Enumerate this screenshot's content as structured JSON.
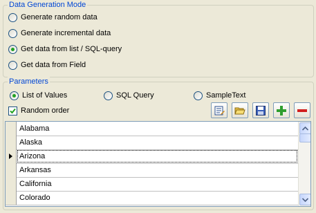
{
  "mode_group": {
    "title": "Data Generation Mode",
    "options": [
      {
        "label": "Generate random data",
        "checked": false
      },
      {
        "label": "Generate incremental data",
        "checked": false
      },
      {
        "label": "Get data from list / SQL-query",
        "checked": true
      },
      {
        "label": "Get data from Field",
        "checked": false
      }
    ]
  },
  "params_group": {
    "title": "Parameters",
    "source_options": [
      {
        "label": "List of Values",
        "checked": true
      },
      {
        "label": "SQL Query",
        "checked": false
      },
      {
        "label": "SampleText",
        "checked": false
      }
    ],
    "random_order": {
      "label": "Random order",
      "checked": true
    },
    "toolbar_icons": [
      "edit-list-icon",
      "open-folder-icon",
      "save-icon",
      "add-icon",
      "remove-icon"
    ]
  },
  "grid": {
    "rows": [
      "Alabama",
      "Alaska",
      "Arizona",
      "Arkansas",
      "California",
      "Colorado"
    ],
    "current_row": 2
  },
  "colors": {
    "group_title": "#0046d5",
    "radio_checked": "#21a121",
    "add_green": "#2f9e2f",
    "remove_red": "#d11f1f"
  }
}
